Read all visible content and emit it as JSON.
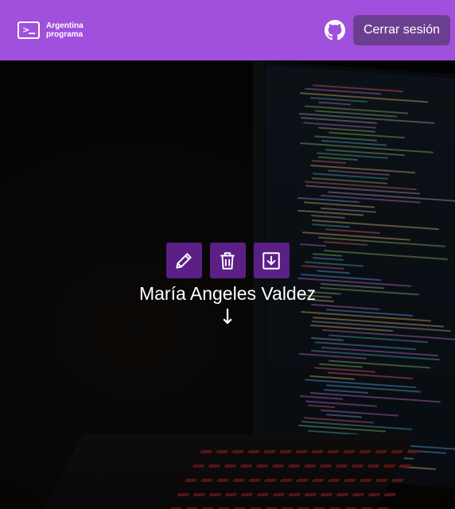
{
  "header": {
    "brand_line1": "Argentina",
    "brand_line2": "programa",
    "logout_label": "Cerrar sesión",
    "bg_color": "#a050dc",
    "logout_bg": "#6b3f90"
  },
  "icons": {
    "brand": "terminal-prompt-icon",
    "github": "github-icon",
    "edit": "pencil-icon",
    "delete": "trash-icon",
    "download": "download-icon",
    "scroll": "arrow-down-icon"
  },
  "profile": {
    "name": "María Angeles Valdez",
    "action_color": "#5b1f86"
  }
}
